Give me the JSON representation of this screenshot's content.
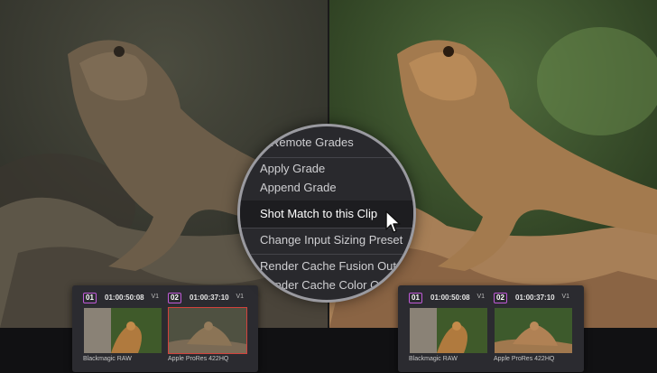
{
  "context_menu": {
    "items": [
      {
        "label": "Remote Grades",
        "state": "partial"
      },
      {
        "label": "Apply Grade"
      },
      {
        "label": "Append Grade"
      },
      {
        "label": "Shot Match to this Clip",
        "highlighted": true
      },
      {
        "label": "Change Input Sizing Preset"
      },
      {
        "label": "Render Cache Fusion Output"
      },
      {
        "label": "Render Cache Color Output"
      }
    ]
  },
  "clip_strips": [
    {
      "clips": [
        {
          "number": "01",
          "timecode": "01:00:50:08",
          "track": "V1",
          "codec": "Blackmagic RAW",
          "selected": false
        },
        {
          "number": "02",
          "timecode": "01:00:37:10",
          "track": "V1",
          "codec": "Apple ProRes 422HQ",
          "selected": true
        }
      ]
    },
    {
      "clips": [
        {
          "number": "01",
          "timecode": "01:00:50:08",
          "track": "V1",
          "codec": "Blackmagic RAW",
          "selected": false
        },
        {
          "number": "02",
          "timecode": "01:00:37:10",
          "track": "V1",
          "codec": "Apple ProRes 422HQ",
          "selected": false
        }
      ]
    }
  ],
  "colors": {
    "clip_number_border": "#c05ad8",
    "selected_clip_border": "#d2423c",
    "menu_background": "#29292d"
  },
  "icons": {
    "cursor": "pointer-arrow-icon"
  }
}
